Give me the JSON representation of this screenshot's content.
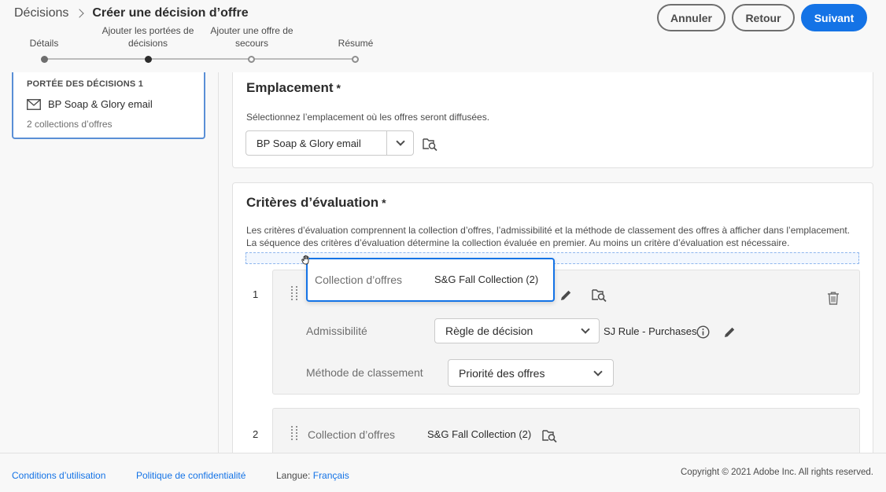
{
  "header": {
    "breadcrumb_root": "Décisions",
    "title": "Créer une décision d’offre",
    "buttons": {
      "cancel": "Annuler",
      "back": "Retour",
      "next": "Suivant"
    }
  },
  "steps": [
    {
      "label": "Détails",
      "state": "done"
    },
    {
      "label": "Ajouter les portées de décisions",
      "state": "current"
    },
    {
      "label": "Ajouter une offre de secours",
      "state": "todo"
    },
    {
      "label": "Résumé",
      "state": "todo"
    }
  ],
  "sidebar": {
    "scope_title": "PORTÉE DES DÉCISIONS 1",
    "scope_item": "BP Soap & Glory email",
    "scope_sub": "2 collections d’offres",
    "icon": "mail-icon"
  },
  "placement": {
    "title": "Emplacement",
    "required": "*",
    "description": "Sélectionnez l’emplacement où les offres seront diffusées.",
    "value": "BP Soap & Glory email"
  },
  "criteria": {
    "title": "Critères d’évaluation",
    "required": "*",
    "description_1": "Les critères d’évaluation comprennent la collection d’offres, l’admissibilité et la méthode de classement des offres à afficher dans l’emplacement.",
    "description_2": "La séquence des critères d’évaluation détermine la collection évaluée en premier. Au moins un critère d’évaluation est nécessaire.",
    "items": [
      {
        "number": "1",
        "collection_label": "Collection d’offres",
        "collection_value": "S&G Fall Collection (2)",
        "eligibility_label": "Admissibilité",
        "eligibility_value": "Règle de décision",
        "rule_name": "SJ Rule - Purchases",
        "ranking_label": "Méthode de classement",
        "ranking_value": "Priorité des offres"
      },
      {
        "number": "2",
        "collection_label": "Collection d’offres",
        "collection_value": "S&G Fall Collection (2)"
      }
    ]
  },
  "footer": {
    "terms": "Conditions d’utilisation",
    "privacy": "Politique de confidentialité",
    "language_label": "Langue:",
    "language_value": "Français",
    "copyright": "Copyright © 2021 Adobe Inc. All rights reserved."
  },
  "colors": {
    "accent": "#1473e6",
    "border": "#e1e1e1"
  }
}
